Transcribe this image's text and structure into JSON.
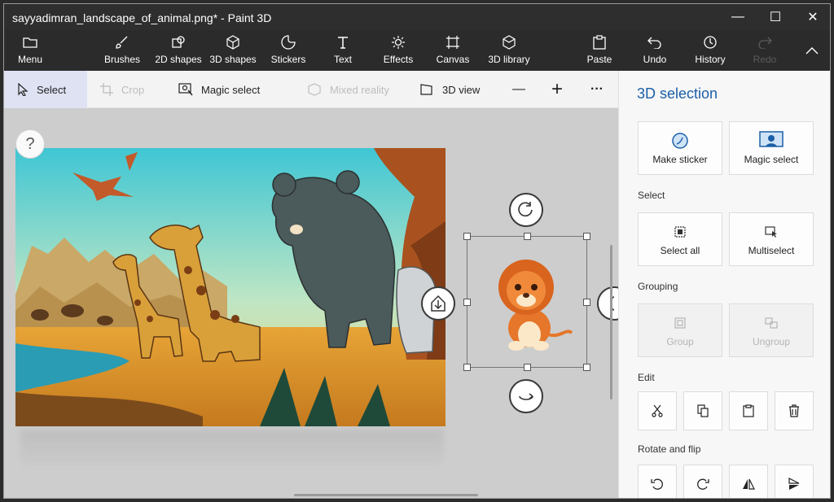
{
  "window": {
    "title": "sayyadimran_landscape_of_animal.png* - Paint 3D",
    "controls": [
      "—",
      "☐",
      "✕"
    ]
  },
  "ribbon": {
    "menu": "Menu",
    "items": [
      {
        "label": "Brushes",
        "icon": "brush-icon"
      },
      {
        "label": "2D shapes",
        "icon": "2d-shapes-icon"
      },
      {
        "label": "3D shapes",
        "icon": "3d-shapes-icon"
      },
      {
        "label": "Stickers",
        "icon": "stickers-icon"
      },
      {
        "label": "Text",
        "icon": "text-icon"
      },
      {
        "label": "Effects",
        "icon": "effects-icon"
      },
      {
        "label": "Canvas",
        "icon": "canvas-icon"
      },
      {
        "label": "3D library",
        "icon": "3d-library-icon"
      }
    ],
    "paste": "Paste",
    "undo": "Undo",
    "history": "History",
    "redo": "Redo"
  },
  "toolbar": {
    "select": "Select",
    "crop": "Crop",
    "magic_select": "Magic select",
    "mixed_reality": "Mixed reality",
    "view_3d": "3D view",
    "zoom_out": "—",
    "zoom_in": "+",
    "more": "···"
  },
  "canvas": {
    "help": "?"
  },
  "panel": {
    "title": "3D selection",
    "make_sticker": "Make sticker",
    "magic_select": "Magic select",
    "select_section": "Select",
    "select_all": "Select all",
    "multiselect": "Multiselect",
    "grouping_section": "Grouping",
    "group": "Group",
    "ungroup": "Ungroup",
    "edit_section": "Edit",
    "rotate_section": "Rotate and flip"
  },
  "colors": {
    "accent": "#1a5fa8",
    "ribbon": "#2b2b2b",
    "canvas": "#cdcdcd"
  }
}
